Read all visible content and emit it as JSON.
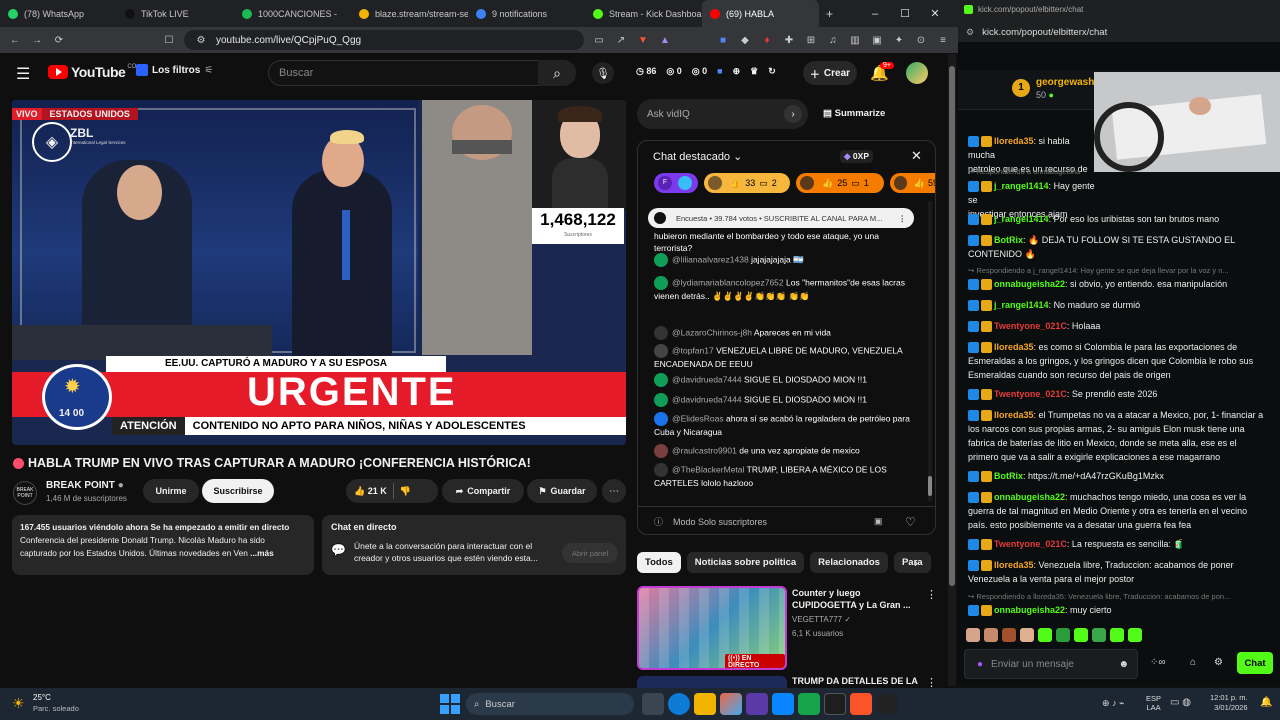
{
  "tabs": [
    {
      "label": "(78) WhatsApp",
      "color": "#25d366"
    },
    {
      "label": "TikTok LIVE",
      "color": "#111"
    },
    {
      "label": "1000CANCIONES -",
      "color": "#1db954"
    },
    {
      "label": "blaze.stream/stream-se",
      "color": "#f5b400"
    },
    {
      "label": "9 notifications",
      "color": "#3b82f6"
    },
    {
      "label": "Stream - Kick Dashboar",
      "color": "#53fc18"
    },
    {
      "label": "(69) HABLA",
      "color": "#ff0000"
    }
  ],
  "address": {
    "url": "youtube.com/live/QCpjPuQ_Qgg"
  },
  "kick_address": {
    "url": "kick.com/popout/elbitterx/chat"
  },
  "yt": {
    "logo": "YouTube",
    "country": "CO",
    "filters_label": "Los filtros",
    "search_placeholder": "Buscar",
    "stats": [
      "86",
      "0",
      "0"
    ],
    "create_label": "Crear",
    "notif_count": "9+"
  },
  "video": {
    "live_label": "VIVO",
    "country_label": "ESTADOS UNIDOS",
    "channel_logo": "ZBL",
    "channel_logo_sub": "International Legal Services",
    "headline": "EE.UU. CAPTURÓ A MADURO Y A SU ESPOSA",
    "banner": "URGENTE",
    "time": "14 00",
    "warning_a": "ATENCIÓN",
    "warning_b": "CONTENIDO NO APTO PARA NIÑOS, NIÑAS Y ADOLESCENTES",
    "counter": "1,468,122",
    "counter_sub": "Suscriptores"
  },
  "title": "HABLA TRUMP EN VIVO TRAS CAPTURAR A MADURO ¡CONFERENCIA HISTÓRICA!",
  "channel": {
    "name": "BREAK POINT",
    "subs": "1,46 M de suscriptores",
    "unsub": "Unirme",
    "subscribe": "Suscribirse",
    "logo": "BREAK POINT"
  },
  "actions": {
    "likes": "21 K",
    "share": "Compartir",
    "save": "Guardar"
  },
  "description": {
    "line1": "167.455 usuarios viéndolo ahora  Se ha empezado a emitir en directo",
    "line2": "Conferencia del presidente Donald Trump. Nicolás Maduro ha sido",
    "line3": "capturado por los Estados Unidos. Últimas novedades en Ven",
    "more": "...más"
  },
  "chat_replay": {
    "title": "Chat en directo",
    "text": "Únete a la conversación para interactuar con el creador y otros usuarios que estén viendo esta...",
    "button": "Abrir panel"
  },
  "vidiq": {
    "placeholder": "Ask vidIQ",
    "summarize": "Summarize"
  },
  "chat": {
    "header": "Chat destacado",
    "xp": "0XP",
    "pinned_counts": [
      "33",
      "2",
      "25",
      "1",
      "59"
    ],
    "poll": "Encuesta • 39.784 votos • SUSCRIBITE AL CANAL PARA M...",
    "messages": [
      {
        "user": "",
        "text": "hubieron mediante el bombardeo y todo ese ataque, yo una terrorista?",
        "av": "#555"
      },
      {
        "user": "@lilianaalvarez1438",
        "text": "jajajajajaja 🇦🇷",
        "av": "#0f9d58"
      },
      {
        "user": "@lydiamariablancolopez7652",
        "text": "Los \"hermanitos\"de esas lacras vienen detrás.. ✌️✌️✌️✌️👏👏👏 👏👏",
        "av": "#0f9d58"
      },
      {
        "user": "@LazaroChirinos-j8h",
        "text": "Apareces en mi vida",
        "av": "#333"
      },
      {
        "user": "@topfan17",
        "text": "VENEZUELA LIBRE DE MADURO, VENEZUELA ENCADENADA DE EEUU",
        "av": "#444"
      },
      {
        "user": "@davidrueda7444",
        "text": "SIGUE EL DIOSDADO MION !!1",
        "av": "#0f9d58"
      },
      {
        "user": "@davidrueda7444",
        "text": "SIGUE EL DIOSDADO MION !!1",
        "av": "#0f9d58"
      },
      {
        "user": "@ElidesRoas",
        "text": "ahora sí se acabó la regaladera de petróleo para Cuba y Nicaragua",
        "av": "#1a73e8"
      },
      {
        "user": "@raulcastro9901",
        "text": "de una vez apropiate de mexico",
        "av": "#7a3e3e"
      },
      {
        "user": "@TheBlackerMetal",
        "text": "TRUMP, LIBERA A MÉXICO DE LOS CARTELES lololo hazlooo",
        "av": "#333"
      }
    ],
    "subs_mode": "Modo Solo suscriptores"
  },
  "chips": [
    "Todos",
    "Noticias sobre política",
    "Relacionados",
    "Para"
  ],
  "reco": [
    {
      "title": "Counter y luego CUPIDOGETTA y La Gran ...",
      "channel": "VEGETTA777",
      "meta": "6,1 K usuarios",
      "badge": "EN DIRECTO"
    },
    {
      "title": "TRUMP DA DETALLES DE LA"
    }
  ],
  "kick": {
    "top_user": "georgewasht",
    "top_amount": "50",
    "messages": [
      {
        "type": "msg",
        "user": "lloreda35",
        "color": "#f5a623",
        "text": "si habla mucha",
        "cont": "petroleo que es un recurso de"
      },
      {
        "type": "reply",
        "text": "Respondiendo a onnabugeisha"
      },
      {
        "type": "msg",
        "user": "j_rangel1414",
        "color": "#53fc18",
        "text": "Hay gente se",
        "cont": "investigar entonces ajam"
      },
      {
        "type": "msg",
        "user": "j_rangel1414",
        "color": "#53fc18",
        "text": "Por eso los uribistas son tan brutos mano"
      },
      {
        "type": "msg",
        "user": "BotRix",
        "color": "#53fc18",
        "text": "🔥 DEJA TU FOLLOW SI TE ESTA GUSTANDO EL CONTENIDO 🔥"
      },
      {
        "type": "reply",
        "text": "Respondiendo a j_rangel1414: Hay gente se que deja llevar por la voz y n..."
      },
      {
        "type": "msg",
        "user": "onnabugeisha22",
        "color": "#53fc18",
        "text": "si obvio, yo entiendo. esa manipulación"
      },
      {
        "type": "msg",
        "user": "j_rangel1414",
        "color": "#53fc18",
        "text": "No maduro se durmió"
      },
      {
        "type": "msg",
        "user": "Twentyone_021C",
        "color": "#e63b3b",
        "text": "Holaaa"
      },
      {
        "type": "msg",
        "user": "lloreda35",
        "color": "#f5a623",
        "text": "es como si Colombia le para las exportaciones de Esmeraldas a los gringos, y los gringos dicen que Colombia le robo sus Esmeraldas cuando son recurso del pais de origen"
      },
      {
        "type": "msg",
        "user": "Twentyone_021C",
        "color": "#e63b3b",
        "text": "Se prendió este 2026"
      },
      {
        "type": "msg",
        "user": "lloreda35",
        "color": "#f5a623",
        "text": "el Trumpetas no va a atacar a Mexico, por, 1- financiar a los narcos con sus propias armas, 2- su amiguis Elon musk tiene una fabrica de baterías de litio en Mexico, donde se meta alla, ese es el primero que va a salir a exigirle explicaciones a ese magarrano"
      },
      {
        "type": "msg",
        "user": "BotRix",
        "color": "#53fc18",
        "text": "https://t.me/+dA47rzGKuBg1Mzkx"
      },
      {
        "type": "msg",
        "user": "onnabugeisha22",
        "color": "#53fc18",
        "text": "muchachos tengo miedo, una cosa es ver la guerra de tal magnitud en Medio Oriente y otra es tenerla en el vecino país. esto posiblemente va a desatar una guerra fea fea"
      },
      {
        "type": "msg",
        "user": "Twentyone_021C",
        "color": "#e63b3b",
        "text": "La respuesta es sencilla: 🧃"
      },
      {
        "type": "msg",
        "user": "lloreda35",
        "color": "#f5a623",
        "text": "Venezuela libre, Traduccion: acabamos de poner Venezuela a la venta para el mejor postor"
      },
      {
        "type": "reply",
        "text": "Respondiendo a lloreda35: Venezuela libre, Traduccion: acabamos de pon..."
      },
      {
        "type": "msg",
        "user": "onnabugeisha22",
        "color": "#53fc18",
        "text": "muy cierto"
      }
    ],
    "input_placeholder": "Enviar un mensaje",
    "chat_button": "Chat"
  },
  "taskbar": {
    "temp": "25°C",
    "weather": "Parc. soleado",
    "search": "Buscar",
    "lang": "ESP",
    "lang2": "LAA",
    "time": "12:01 p. m.",
    "date": "3/01/2026"
  }
}
